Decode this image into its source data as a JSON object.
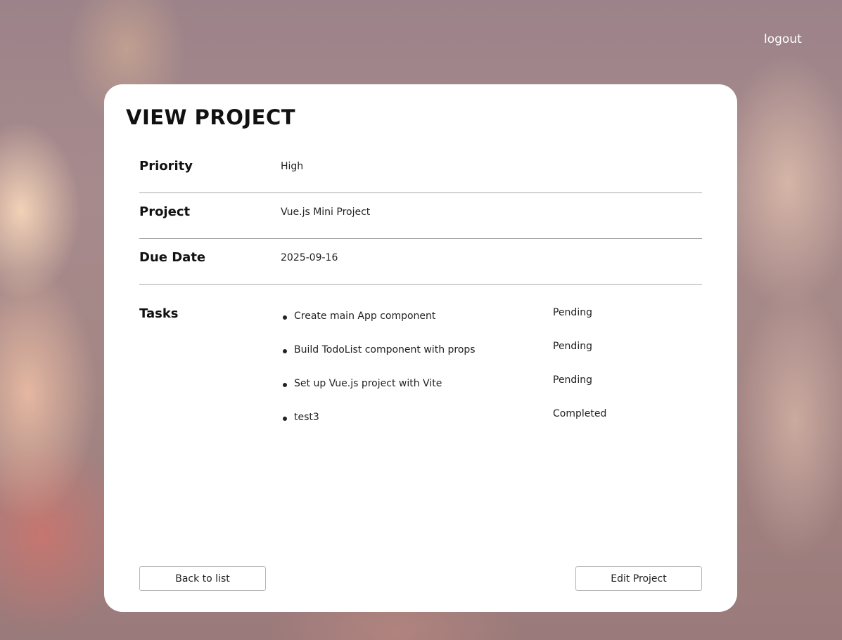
{
  "header": {
    "logout_label": "logout"
  },
  "card": {
    "title": "VIEW PROJECT",
    "fields": {
      "priority": {
        "label": "Priority",
        "value": "High"
      },
      "project": {
        "label": "Project",
        "value": "Vue.js Mini Project"
      },
      "due_date": {
        "label": "Due Date",
        "value": "2025-09-16"
      }
    },
    "tasks": {
      "label": "Tasks",
      "items": [
        {
          "name": "Create main App component",
          "status": "Pending"
        },
        {
          "name": "Build TodoList component with props",
          "status": "Pending"
        },
        {
          "name": "Set up Vue.js project with Vite",
          "status": "Pending"
        },
        {
          "name": "test3",
          "status": "Completed"
        }
      ]
    },
    "actions": {
      "back_label": "Back to list",
      "edit_label": "Edit Project"
    }
  }
}
